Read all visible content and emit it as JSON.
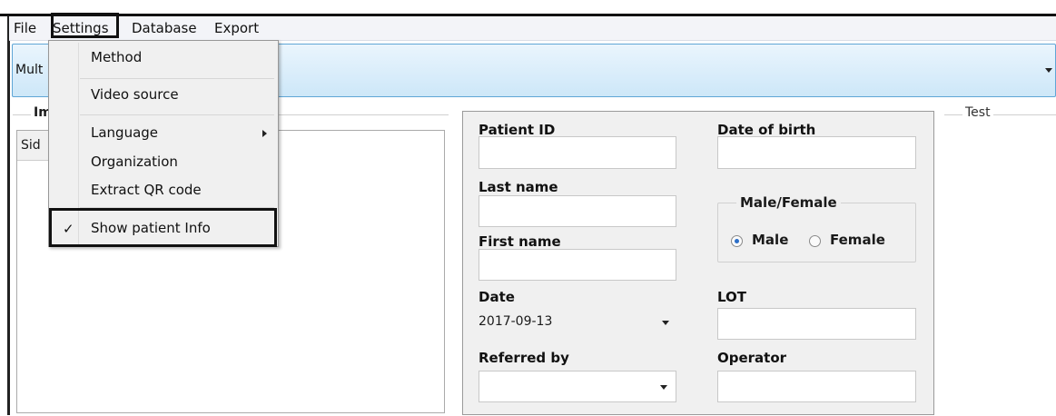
{
  "menubar": {
    "file": "File",
    "settings": "Settings",
    "database": "Database",
    "export": "Export"
  },
  "method_combo": {
    "value": "Mult"
  },
  "image_group": {
    "title": "Im",
    "tab_label": "Sid"
  },
  "settings_menu": {
    "items": [
      {
        "label": "Method"
      },
      {
        "label": "Video source"
      },
      {
        "label": "Language",
        "has_submenu": true
      },
      {
        "label": "Organization"
      },
      {
        "label": "Extract QR code"
      },
      {
        "label": "Show patient Info",
        "checked": true
      }
    ],
    "check_glyph": "✓"
  },
  "patient": {
    "patient_id_label": "Patient ID",
    "patient_id_value": "",
    "dob_label": "Date of birth",
    "dob_value": "",
    "last_name_label": "Last name",
    "last_name_value": "",
    "first_name_label": "First name",
    "first_name_value": "",
    "sex_group_title": "Male/Female",
    "male_label": "Male",
    "female_label": "Female",
    "sex_selected": "Male",
    "date_label": "Date",
    "date_value": "2017-09-13",
    "lot_label": "LOT",
    "lot_value": "",
    "referred_by_label": "Referred by",
    "referred_by_value": "",
    "operator_label": "Operator",
    "operator_value": ""
  },
  "test_group": {
    "title": "Test"
  },
  "colors": {
    "accent_border": "#5fa6d6",
    "radio_selected": "#2c6fc8",
    "panel_bg": "#f0f0f0"
  }
}
